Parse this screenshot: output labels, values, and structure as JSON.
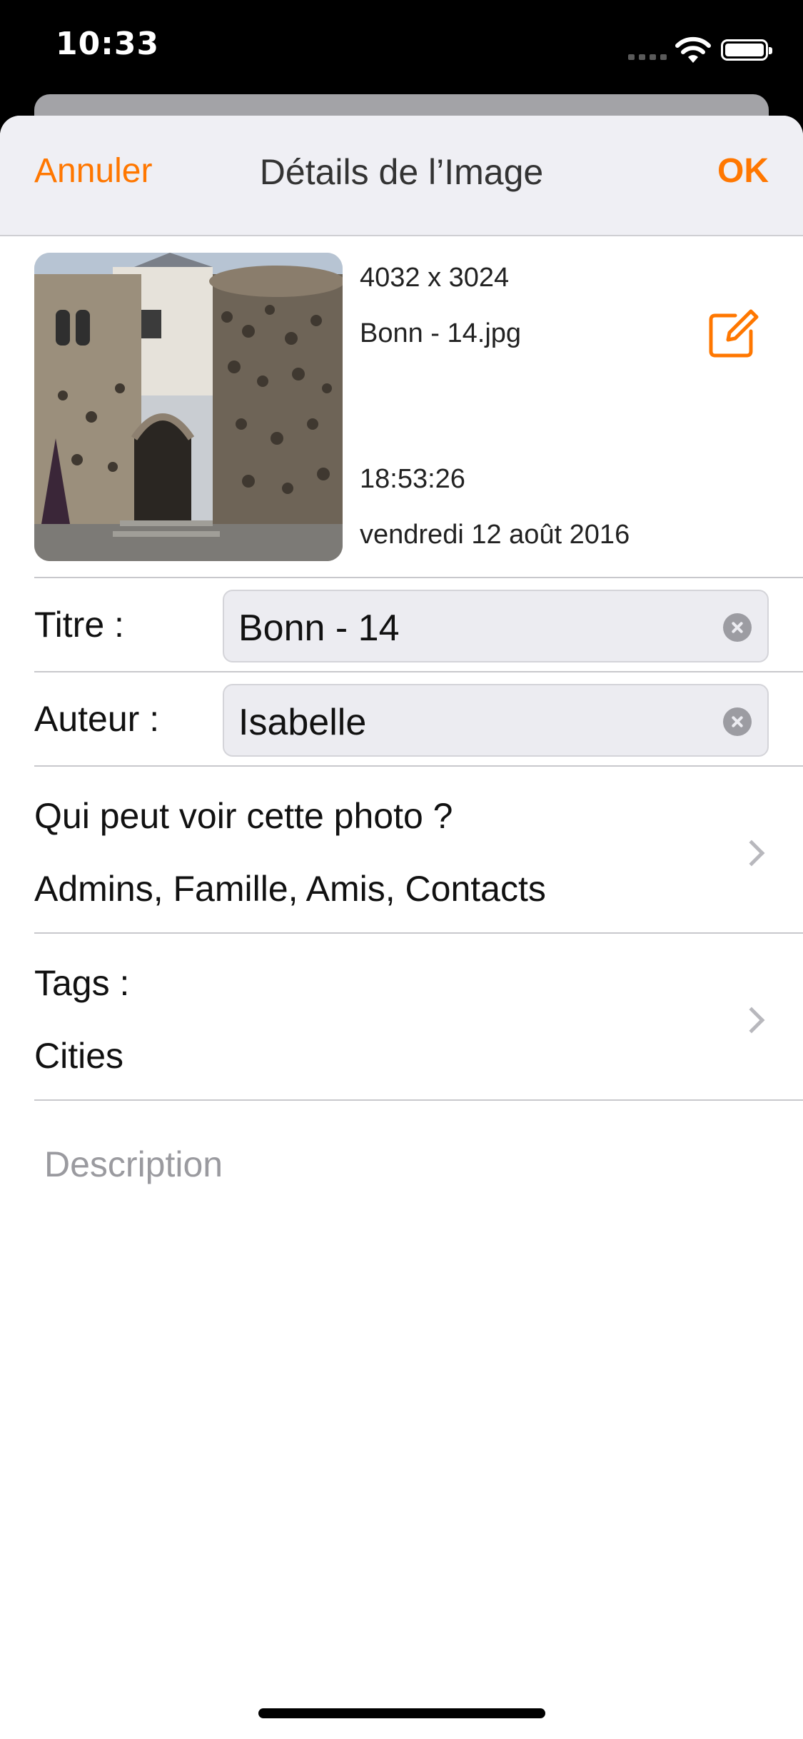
{
  "status_bar": {
    "time": "10:33"
  },
  "nav": {
    "cancel_label": "Annuler",
    "title": "Détails de l’Image",
    "ok_label": "OK"
  },
  "image": {
    "dimensions": "4032 x 3024",
    "filename": "Bonn - 14.jpg",
    "time": "18:53:26",
    "date": "vendredi 12 août 2016"
  },
  "form": {
    "title_label": "Titre :",
    "title_value": "Bonn - 14",
    "author_label": "Auteur :",
    "author_value": "Isabelle",
    "privacy_label": "Qui peut voir cette photo ?",
    "privacy_value": "Admins, Famille, Amis, Contacts",
    "tags_label": "Tags :",
    "tags_value": "Cities",
    "description_placeholder": "Description"
  },
  "colors": {
    "accent": "#ff7700",
    "nav_background": "#efeff4"
  },
  "icons": {
    "edit": "edit-icon",
    "clear": "clear-icon",
    "chevron": "chevron-right-icon",
    "wifi": "wifi-icon",
    "battery": "battery-icon"
  }
}
